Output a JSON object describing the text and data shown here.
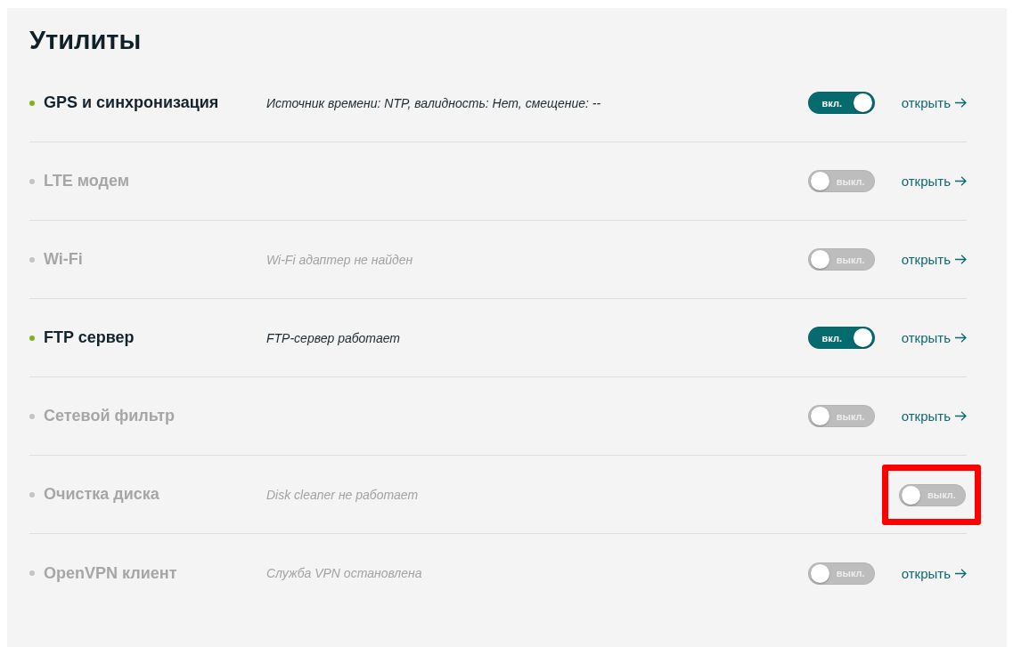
{
  "title": "Утилиты",
  "rows": [
    {
      "name": "GPS и синхронизация",
      "active": true,
      "status": "Источник времени: NTP, валидность: Нет, смещение: --",
      "toggle": {
        "on": true,
        "label": "вкл."
      },
      "link": "открыть",
      "highlighted": false
    },
    {
      "name": "LTE модем",
      "active": false,
      "toggle": {
        "on": false,
        "label": "выкл."
      },
      "link": "открыть",
      "highlighted": false
    },
    {
      "name": "Wi-Fi",
      "active": false,
      "status": "Wi-Fi адаптер не найден",
      "toggle": {
        "on": false,
        "label": "выкл."
      },
      "link": "открыть",
      "highlighted": false
    },
    {
      "name": "FTP сервер",
      "active": true,
      "status": "FTP-сервер работает",
      "toggle": {
        "on": true,
        "label": "вкл."
      },
      "link": "открыть",
      "highlighted": false
    },
    {
      "name": "Сетевой фильтр",
      "active": false,
      "toggle": {
        "on": false,
        "label": "выкл."
      },
      "link": "открыть",
      "highlighted": false
    },
    {
      "name": "Очистка диска",
      "active": false,
      "status": "Disk cleaner не работает",
      "toggle": {
        "on": false,
        "label": "выкл."
      },
      "highlighted": true
    },
    {
      "name": "OpenVPN клиент",
      "active": false,
      "status": "Служба VPN остановлена",
      "toggle": {
        "on": false,
        "label": "выкл."
      },
      "link": "открыть",
      "highlighted": false
    }
  ]
}
